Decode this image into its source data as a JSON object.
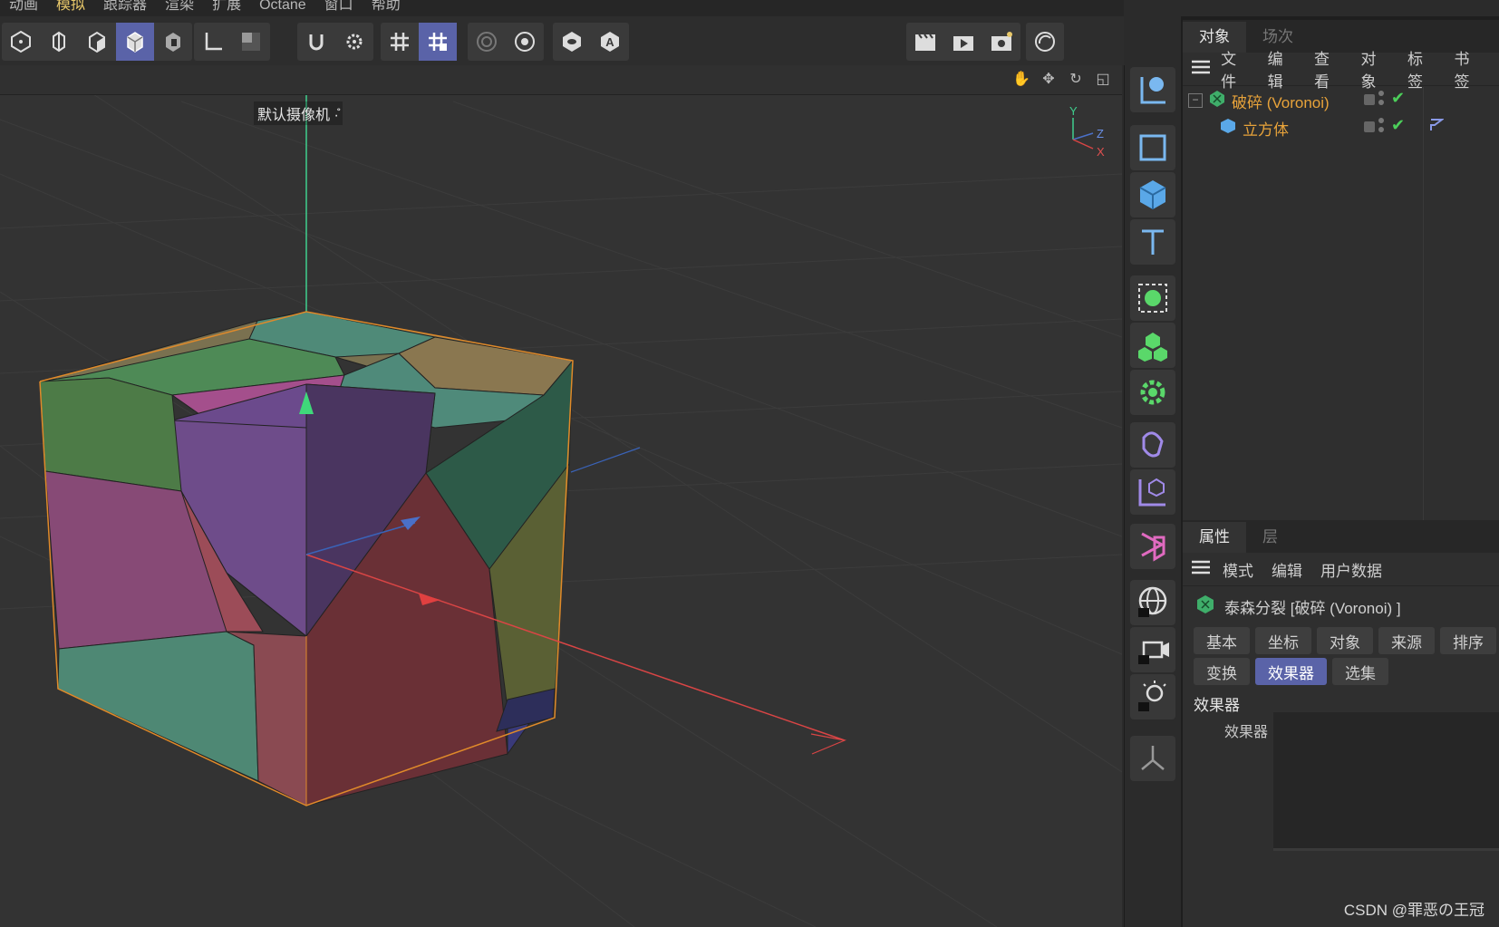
{
  "menubar": {
    "items": [
      "动画",
      "模拟",
      "跟踪器",
      "渲染",
      "扩展",
      "Octane",
      "窗口",
      "帮助"
    ]
  },
  "viewport": {
    "camera_label": "默认摄像机 ·̊",
    "axis_labels": {
      "y": "Y",
      "z": "Z",
      "x": "X"
    }
  },
  "object_manager": {
    "tabs": [
      "对象",
      "场次"
    ],
    "menu": [
      "文件",
      "编辑",
      "查看",
      "对象",
      "标签",
      "书签"
    ],
    "objects": [
      {
        "name": "破碎 (Voronoi)",
        "color": "#e8a33a",
        "icon": "voronoi-icon"
      },
      {
        "name": "立方体",
        "color": "#e8a33a",
        "icon": "cube-icon"
      }
    ]
  },
  "attributes": {
    "tabs": [
      "属性",
      "层"
    ],
    "menu": [
      "模式",
      "编辑",
      "用户数据"
    ],
    "object_title": "泰森分裂 [破碎 (Voronoi) ]",
    "sub_tabs_row1": [
      "基本",
      "坐标",
      "对象",
      "来源",
      "排序"
    ],
    "sub_tabs_row2": [
      "变换",
      "效果器",
      "选集"
    ],
    "active_tab": "效果器",
    "section_title": "效果器",
    "field_label": "效果器"
  },
  "watermark": "CSDN @罪恶の王冠",
  "colors": {
    "accent": "#5a63a8",
    "selected_object": "#e8a33a",
    "check": "#4ccf5a"
  }
}
